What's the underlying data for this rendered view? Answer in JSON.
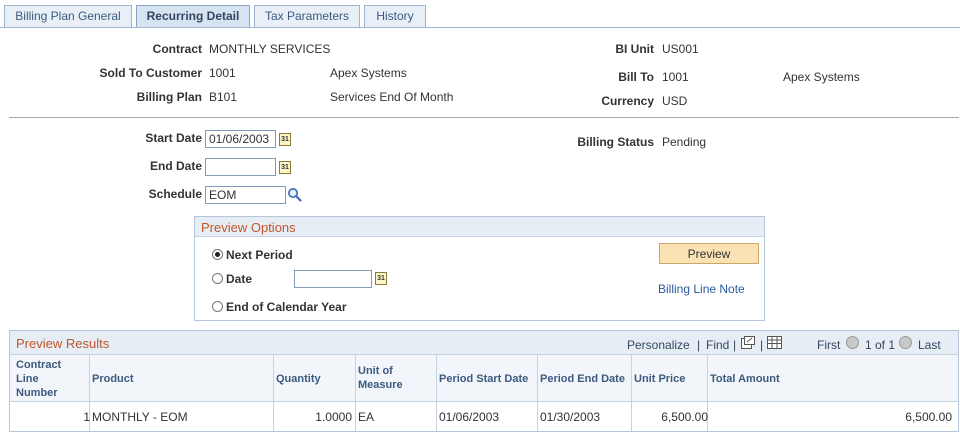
{
  "tabs": [
    {
      "label": "Billing Plan General",
      "active": false
    },
    {
      "label": "Recurring Detail",
      "active": true
    },
    {
      "label": "Tax Parameters",
      "active": false
    },
    {
      "label": "History",
      "active": false
    }
  ],
  "header": {
    "contract_label": "Contract",
    "contract_value": "MONTHLY SERVICES",
    "bi_unit_label": "BI Unit",
    "bi_unit_value": "US001",
    "sold_to_label": "Sold To Customer",
    "sold_to_id": "1001",
    "sold_to_name": "Apex Systems",
    "bill_to_label": "Bill To",
    "bill_to_id": "1001",
    "bill_to_name": "Apex Systems",
    "billing_plan_label": "Billing Plan",
    "billing_plan_id": "B101",
    "billing_plan_desc": "Services End Of Month",
    "currency_label": "Currency",
    "currency_value": "USD"
  },
  "schedule": {
    "start_date_label": "Start Date",
    "start_date_value": "01/06/2003",
    "end_date_label": "End Date",
    "end_date_value": "",
    "schedule_label": "Schedule",
    "schedule_value": "EOM",
    "billing_status_label": "Billing Status",
    "billing_status_value": "Pending",
    "calendar_glyph": "31"
  },
  "preview_options": {
    "title": "Preview Options",
    "next_period_label": "Next Period",
    "date_label": "Date",
    "date_value": "",
    "end_of_year_label": "End of Calendar Year",
    "selected": "next_period",
    "preview_button": "Preview",
    "billing_line_note": "Billing Line Note"
  },
  "preview_results": {
    "title": "Preview Results",
    "personalize": "Personalize",
    "separator": "|",
    "find": "Find",
    "first": "First",
    "range": "1 of 1",
    "last": "Last",
    "columns": {
      "line_a": "Contract",
      "line_b": "Line",
      "line_c": "Number",
      "product": "Product",
      "quantity": "Quantity",
      "uom_a": "Unit of",
      "uom_b": "Measure",
      "period_start": "Period Start Date",
      "period_end": "Period End Date",
      "unit_price": "Unit Price",
      "total_amount": "Total Amount"
    },
    "rows": [
      {
        "line": "1",
        "product": "MONTHLY - EOM",
        "quantity": "1.0000",
        "uom": "EA",
        "period_start": "01/06/2003",
        "period_end": "01/30/2003",
        "unit_price": "6,500.00",
        "total_amount": "6,500.00"
      }
    ]
  },
  "icons": {
    "calendar": "calendar-icon",
    "lookup": "magnifier-icon",
    "view_all": "view-all-icon",
    "download": "spreadsheet-icon",
    "prev": "prev-arrow-icon",
    "next": "next-arrow-icon"
  },
  "colors": {
    "section_title": "#c0562b",
    "link": "#2a5aa0",
    "tab_border": "#9fb6d2",
    "button_bg": "#fbe2b2"
  }
}
